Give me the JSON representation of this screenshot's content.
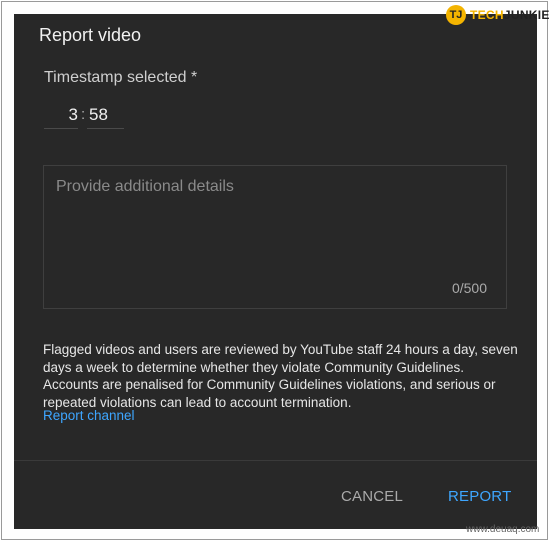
{
  "dialog": {
    "title": "Report video",
    "timestamp_label": "Timestamp selected *",
    "timestamp_minutes": "3",
    "timestamp_separator": ":",
    "timestamp_seconds": "58",
    "details_placeholder": "Provide additional details",
    "char_counter": "0/500",
    "info_text": "Flagged videos and users are reviewed by YouTube staff 24 hours a day, seven days a week to determine whether they violate Community Guidelines. Accounts are penalised for Community Guidelines violations, and serious or repeated violations can lead to account termination.",
    "report_channel_link": "Report channel",
    "cancel_label": "CANCEL",
    "report_label": "REPORT"
  },
  "logo": {
    "badge": "TJ",
    "brand_part1": "TECH",
    "brand_part2": "JUNKIE"
  },
  "watermark": "www.deuaq.com",
  "colors": {
    "dialog_bg": "#282828",
    "accent_blue": "#3ea6ff",
    "logo_yellow": "#f4b400"
  }
}
